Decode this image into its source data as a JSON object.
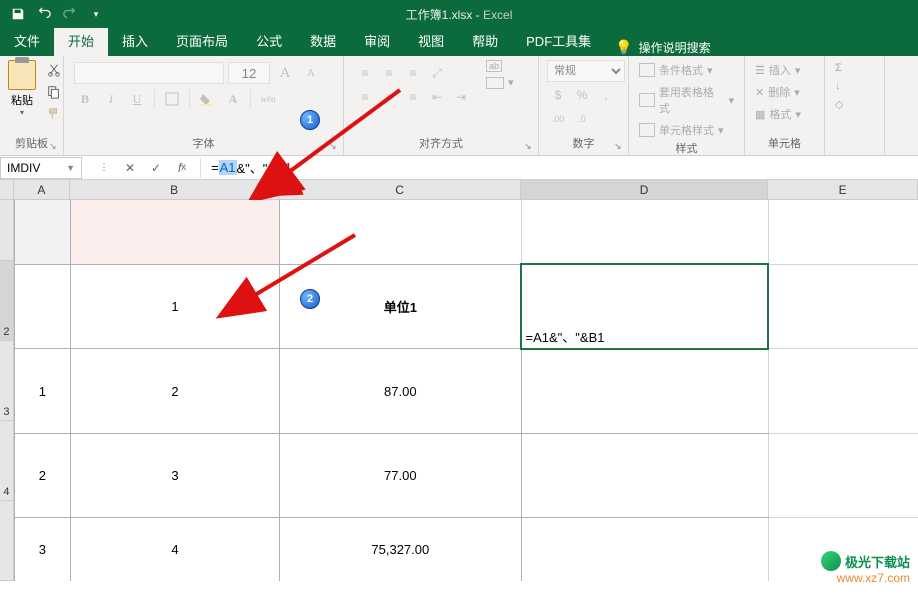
{
  "title": {
    "filename": "工作簿1.xlsx",
    "app": "Excel"
  },
  "qat": {
    "save": "save-icon",
    "undo": "undo-icon",
    "redo": "redo-icon"
  },
  "menu": {
    "file": "文件",
    "home": "开始",
    "insert": "插入",
    "layout": "页面布局",
    "formulas": "公式",
    "data": "数据",
    "review": "审阅",
    "view": "视图",
    "help": "帮助",
    "pdf": "PDF工具集",
    "tellme": "操作说明搜索"
  },
  "ribbon": {
    "clipboard": {
      "paste": "粘贴",
      "label": "剪贴板"
    },
    "font": {
      "size": "12",
      "A_inc": "A",
      "A_dec": "A",
      "wen": "wén",
      "label": "字体",
      "B": "B",
      "I": "I",
      "U": "U"
    },
    "align": {
      "wrap": "ab",
      "merge_label": "",
      "label": "对齐方式"
    },
    "number": {
      "format": "常规",
      "sym": "%",
      "comma": ",",
      "label": "数字"
    },
    "styles": {
      "cond": "条件格式",
      "fmt_table": "套用表格格式",
      "cell_styles": "单元格样式",
      "label": "样式"
    },
    "cells": {
      "insert": "插入",
      "delete": "删除",
      "format": "格式",
      "label": "单元格"
    },
    "editing": {
      "sum": "Σ",
      "fill": "↓",
      "clear": "◇"
    }
  },
  "formula_bar": {
    "name_box": "IMDIV",
    "formula_prefix": "=",
    "ref1": "A1",
    "mid": "&\"、\"&",
    "ref2": "B1"
  },
  "columns": [
    "A",
    "B",
    "C",
    "D",
    "E"
  ],
  "row_labels": [
    "",
    "2",
    "3",
    "4",
    ""
  ],
  "cells": {
    "B2": "1",
    "C2": "单位1",
    "D2": "=A1&\"、\"&B1",
    "A3": "1",
    "B3": "2",
    "C3": "87.00",
    "A4": "2",
    "B4": "3",
    "C4": "77.00",
    "A5": "3",
    "B5": "4",
    "C5": "75,327.00"
  },
  "badges": {
    "b1": "1",
    "b2": "2"
  },
  "watermark": {
    "name": "极光下载站",
    "url": "www.xz7.com"
  },
  "chart_data": {
    "type": "table",
    "columns": [
      "",
      "",
      "单位1"
    ],
    "rows": [
      [
        1,
        2,
        87.0
      ],
      [
        2,
        3,
        77.0
      ],
      [
        3,
        4,
        75327.0
      ]
    ]
  }
}
